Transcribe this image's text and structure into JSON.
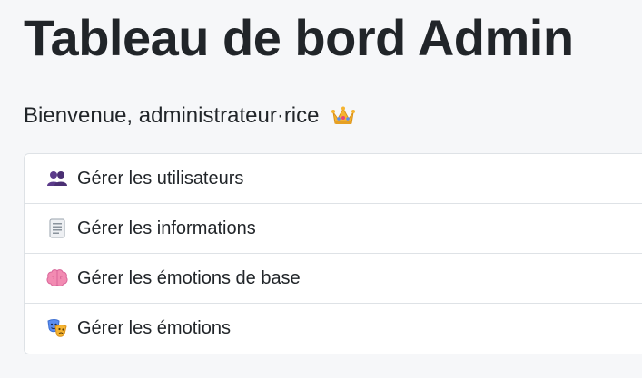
{
  "page": {
    "title": "Tableau de bord Admin",
    "welcome_text": "Bienvenue, administrateur·rice",
    "welcome_icon": "crown-icon"
  },
  "menu": {
    "items": [
      {
        "label": "Gérer les utilisateurs",
        "icon": "users-icon"
      },
      {
        "label": "Gérer les informations",
        "icon": "document-icon"
      },
      {
        "label": "Gérer les émotions de base",
        "icon": "brain-icon"
      },
      {
        "label": "Gérer les émotions",
        "icon": "theater-masks-icon"
      }
    ]
  },
  "colors": {
    "background": "#f6f7f9",
    "card": "#ffffff",
    "border": "#dee2e6",
    "text": "#212529"
  }
}
